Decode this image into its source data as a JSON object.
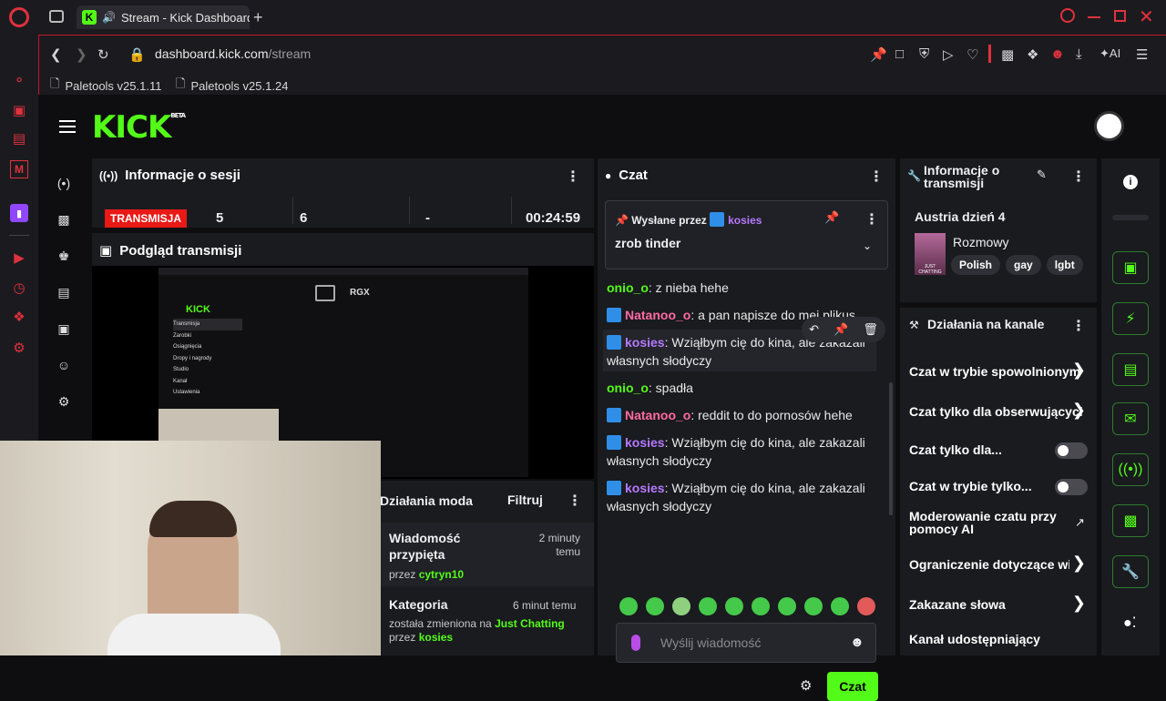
{
  "browser": {
    "tab_title": "Stream - Kick Dashboard",
    "url_domain": "dashboard.kick.com",
    "url_path": "/stream",
    "bookmarks": [
      "Paletools v25.1.11",
      "Paletools v25.1.24"
    ],
    "ai_label": "AI"
  },
  "header": {
    "logo": "KICK",
    "beta": "BETA"
  },
  "session": {
    "title": "Informacje o sesji",
    "status": "TRANSMISJA",
    "stat1": "5",
    "stat2": "6",
    "stat3": "-",
    "timer": "00:24:59"
  },
  "preview": {
    "title": "Podgląd transmisji",
    "mini_labels": [
      "Transmisja",
      "Zarobki",
      "Osiągnięcia",
      "Dropy i nagrody",
      "Studio",
      "Kanał",
      "Ustawienia"
    ],
    "rgx": "RGX"
  },
  "modactions": {
    "title": "Działania moda",
    "filter": "Filtruj",
    "item1_title": "Wiadomość przypięta",
    "item1_time": "2 minuty temu",
    "item1_by_prefix": "przez",
    "item1_by": "cytryn10",
    "item2_title": "Kategoria",
    "item2_time": "6 minut temu",
    "item2_desc": "została zmieniona na",
    "item2_cat": "Just Chatting",
    "item2_by_prefix": "przez",
    "item2_by": "kosies"
  },
  "chat": {
    "title": "Czat",
    "pinned_prefix": "Wysłane przez",
    "pinned_user": "kosies",
    "pinned_text": "zrob tinder",
    "messages": [
      {
        "user": "onio_o",
        "text": ": z nieba hehe"
      },
      {
        "user": "Natanoo_o",
        "text": ": a pan napisze do mei plikus"
      },
      {
        "user": "kosies",
        "text": ": Wziąłbym cię do kina, ale zakazali własnych słodyczy"
      },
      {
        "user": "onio_o",
        "text": ": spadła"
      },
      {
        "user": "Natanoo_o",
        "text": ": reddit to do pornosów hehe"
      },
      {
        "user": "kosies",
        "text": ": Wziąłbym cię do kina, ale zakazali własnych słodyczy"
      },
      {
        "user": "kosies",
        "text": ": Wziąłbym cię do kina, ale zakazali własnych słodyczy"
      }
    ],
    "input_placeholder": "Wyślij wiadomość",
    "send_label": "Czat"
  },
  "streaminfo": {
    "title": "Informacje o transmisji",
    "stream_title": "Austria dzień 4",
    "category": "Rozmowy",
    "thumb_text": "JUST CHATTING",
    "tags": [
      "Polish",
      "gay",
      "lgbt"
    ]
  },
  "channel": {
    "title": "Działania na kanale",
    "items": [
      "Czat w trybie spowolnionym",
      "Czat tylko dla obserwujących",
      "Czat tylko dla...",
      "Czat w trybie tylko...",
      "Moderowanie czatu przy pomocy AI",
      "Ograniczenie dotyczące wiadomości",
      "Zakazane słowa",
      "Kanał udostępniający"
    ]
  },
  "colors": {
    "accent": "#53fc18",
    "live": "#e91916",
    "browser_red": "#e0313d"
  }
}
